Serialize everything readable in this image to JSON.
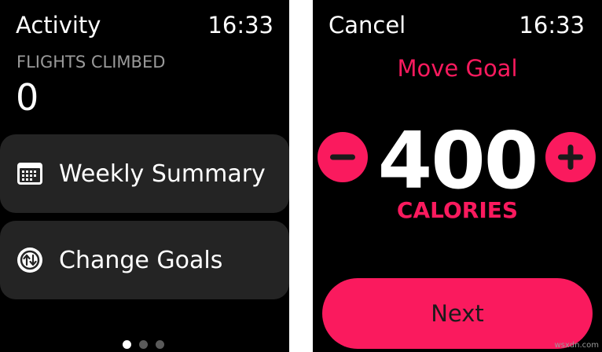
{
  "left_screen": {
    "title": "Activity",
    "time": "16:33",
    "metric": {
      "label": "FLIGHTS CLIMBED",
      "value": "0"
    },
    "menu": [
      {
        "label": "Weekly Summary",
        "icon": "calendar-icon"
      },
      {
        "label": "Change Goals",
        "icon": "change-goals-icon"
      }
    ],
    "pagination": {
      "total": 3,
      "active": 1
    }
  },
  "right_screen": {
    "cancel_label": "Cancel",
    "time": "16:33",
    "goal_title": "Move Goal",
    "goal_value": "400",
    "goal_unit": "CALORIES",
    "minus_icon": "minus-icon",
    "plus_icon": "plus-icon",
    "next_label": "Next"
  },
  "watermark": "wsxdn.com",
  "colors": {
    "background": "#000000",
    "card": "#242424",
    "accent": "#fa1a5e",
    "secondary_text": "#9a9a9a"
  }
}
